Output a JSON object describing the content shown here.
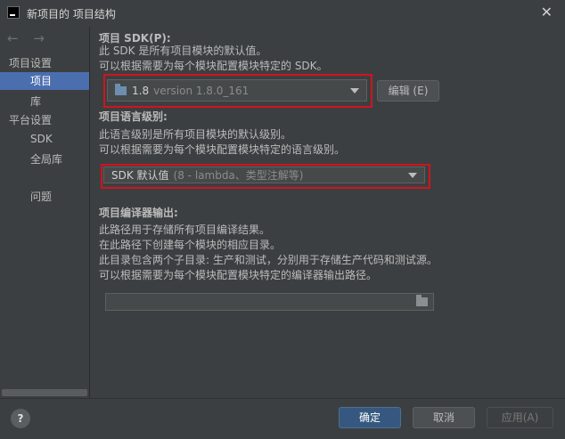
{
  "window": {
    "title": "新项目的 项目结构"
  },
  "sidebar": {
    "nav_arrows": "← →",
    "items": [
      {
        "label": "项目设置"
      },
      {
        "label": "项目"
      },
      {
        "label": "库"
      },
      {
        "label": "平台设置"
      },
      {
        "label": "SDK"
      },
      {
        "label": "全局库"
      },
      {
        "label": "问题"
      }
    ]
  },
  "sdk": {
    "header": "项目 SDK(P):",
    "desc1": "此 SDK 是所有项目模块的默认值。",
    "desc2": "可以根据需要为每个模块配置模块特定的 SDK。",
    "selected_name": "1.8",
    "selected_version": "version 1.8.0_161",
    "edit_label": "编辑 (E)"
  },
  "language": {
    "header": "项目语言级别:",
    "desc1": "此语言级别是所有项目模块的默认级别。",
    "desc2": "可以根据需要为每个模块配置模块特定的语言级别。",
    "selected_main": "SDK 默认值",
    "selected_detail": "(8 - lambda、类型注解等)"
  },
  "output": {
    "header": "项目编译器输出:",
    "desc1": "此路径用于存储所有项目编译结果。",
    "desc2": "在此路径下创建每个模块的相应目录。",
    "desc3": "此目录包含两个子目录: 生产和测试，分别用于存储生产代码和测试源。",
    "desc4": "可以根据需要为每个模块配置模块特定的编译器输出路径。",
    "path_value": ""
  },
  "footer": {
    "help": "?",
    "ok": "确定",
    "cancel": "取消",
    "apply": "应用(A)"
  },
  "colors": {
    "highlight": "#d0141e",
    "selection": "#4b6eaf",
    "primary_button": "#365880"
  }
}
